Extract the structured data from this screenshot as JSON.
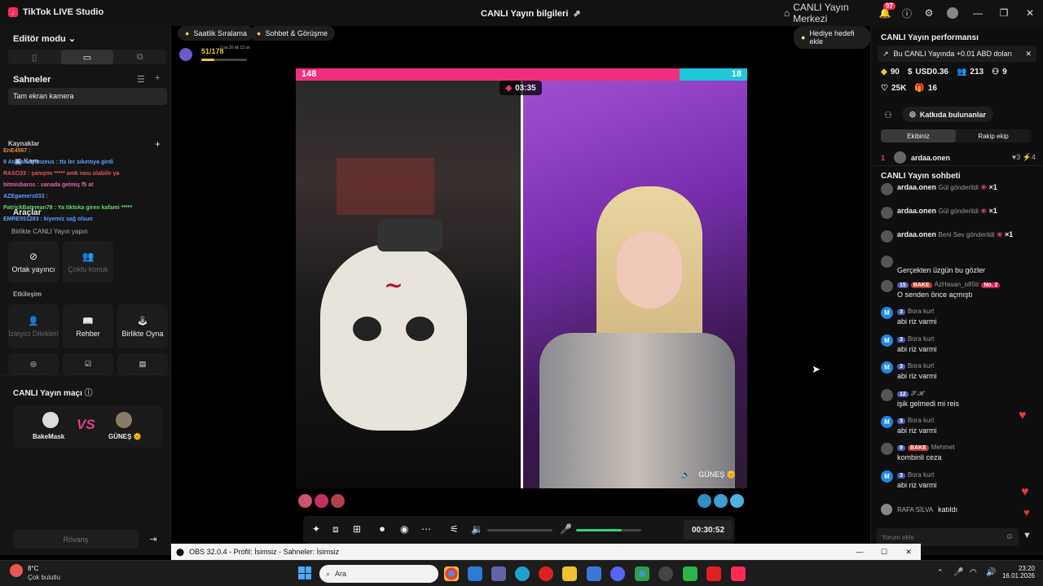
{
  "titlebar": {
    "app_name": "TikTok LIVE Studio",
    "center_title": "CANLI Yayın bilgileri",
    "live_center": "CANLI Yayın Merkezi",
    "notif_count": "97"
  },
  "left": {
    "editor_mode": "Editör modu",
    "scenes_title": "Sahneler",
    "scene_item": "Tam ekran kamera",
    "sources_title": "Kaynaklar",
    "tools_title": "Araçlar",
    "collab_title": "Birlikte CANLI Yayın yapın",
    "tool_cohost": "Ortak yayıncı",
    "tool_multi": "Çoklu konuk",
    "interaction_title": "Etkileşim",
    "tool_requests": "İzleyici Dilekleri",
    "tool_guide": "Rehber",
    "tool_playtogether": "Birlikte Oyna",
    "match_title": "CANLI Yayın maçı",
    "player1": "BakeMask",
    "player2": "GÜNEŞ 🌞",
    "rematch": "Rövanş"
  },
  "overlay_chat": [
    "EnE4567 :",
    "9 Atanamayanzeus : tts ler sıkıntıya girdi",
    "RASO33 : şanışmı ***** amk nası olabilir ya",
    "bitmisbaros : sanada gelmiş f5 at",
    "AZEgamers033 :",
    "PatrickBateman78 : Ya tiktoka giren kafami *****",
    "EMRE551283 : kiyemiz sağ olsun"
  ],
  "overlay_partial": "Kam",
  "stage": {
    "hourly_rank": "Saatlik Sıralama",
    "chat_meet": "Sohbet & Görüşme",
    "gift_goal": "Hediye hedefi ekle",
    "progress": "51/178",
    "progress_fraction": 0.29,
    "progress_time": "2 sa 20 dk 13 sn",
    "score_left": "148",
    "score_right": "18",
    "timer": "03:35",
    "guest_name": "GÜNEŞ 🌞",
    "elapsed": "00:30:52",
    "volume_level": 0.7
  },
  "right": {
    "perf_title": "CANLI Yayın performansı",
    "perf_banner": "Bu CANLI Yayında +0.01 ABD doları",
    "stat_diamonds": "90",
    "stat_usd": "USD0.36",
    "stat_viewers": "213",
    "stat_new": "9",
    "stat_likes": "25K",
    "stat_gifts": "16",
    "contrib_btn": "Katkıda bulunanlar",
    "tab_mine": "Ekibiniz",
    "tab_rival": "Rakip ekip",
    "rank1": "1",
    "rank1_name": "ardaa.onen",
    "rank1_a": "3",
    "rank1_b": "4",
    "chat_title": "CANLI Yayın sohbeti",
    "gifts": [
      {
        "user": "ardaa.onen",
        "text": "Gül gönderildi",
        "count": "×1"
      },
      {
        "user": "ardaa.onen",
        "text": "Gül gönderildi",
        "count": "×1"
      },
      {
        "user": "ardaa.onen",
        "text": "Beni Sev gönderildi",
        "count": "×1"
      }
    ],
    "messages": [
      {
        "name": "",
        "lvl": "",
        "text": "Gerçekten üzgün bu gözler"
      },
      {
        "name": "AzHasan_o85tr",
        "lvl": "15",
        "text": "O senden önce açmıştı"
      },
      {
        "name": "Bora kurt",
        "lvl": "3",
        "text": "abi riz varmi"
      },
      {
        "name": "Bora kurt",
        "lvl": "3",
        "text": "abi riz varmi"
      },
      {
        "name": "Bora kurt",
        "lvl": "3",
        "text": "abi riz varmi"
      },
      {
        "name": "𝓢.𝓗",
        "lvl": "12",
        "text": "işik gelmedi mi reis"
      },
      {
        "name": "Bora kurt",
        "lvl": "3",
        "text": "abi riz varmi"
      },
      {
        "name": "Mehmet",
        "lvl": "9",
        "text": "kombinli ceza"
      },
      {
        "name": "Bora kurt",
        "lvl": "3",
        "text": "abi riz varmi"
      }
    ],
    "bake_tag": "BAKE",
    "no2": "No. 2",
    "joined_user": "RAFA SİLVA",
    "joined_text": "katıldı",
    "comment_placeholder": "Yorum ekle"
  },
  "obs": {
    "title": "OBS 32.0.4 - Profil: İsimsiz - Sahneler: İsimsiz"
  },
  "taskbar": {
    "temp": "8°C",
    "weather": "Çok bulutlu",
    "search": "Ara",
    "time": "23:20",
    "date": "16.01.2026"
  }
}
